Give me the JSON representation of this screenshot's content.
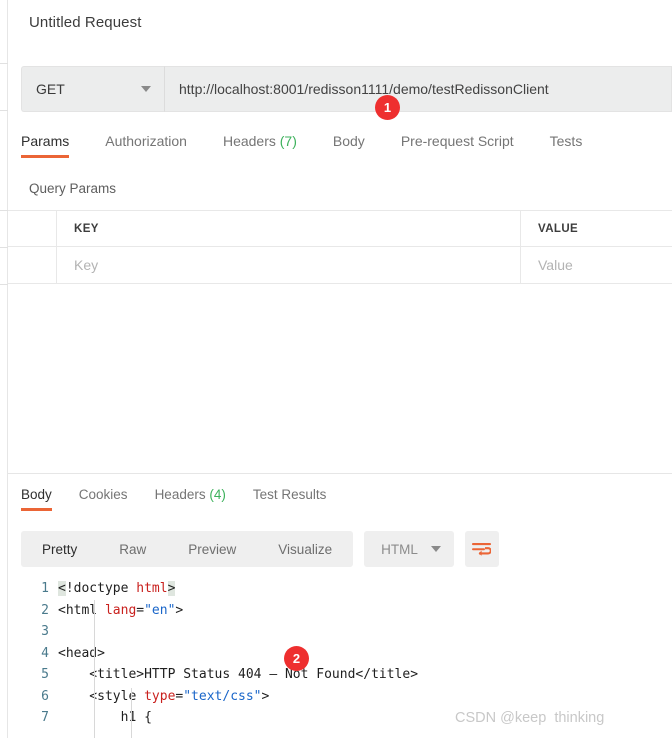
{
  "request": {
    "title": "Untitled Request",
    "method": "GET",
    "method_caret_icon": "chevron-down-icon",
    "url": "http://localhost:8001/redisson1111/demo/testRedissonClient",
    "tabs": [
      {
        "label": "Params",
        "active": true
      },
      {
        "label": "Authorization",
        "active": false
      },
      {
        "label": "Headers",
        "count": "(7)",
        "active": false
      },
      {
        "label": "Body",
        "active": false
      },
      {
        "label": "Pre-request Script",
        "active": false
      },
      {
        "label": "Tests",
        "active": false
      }
    ]
  },
  "query_params": {
    "section_label": "Query Params",
    "columns": [
      "KEY",
      "VALUE"
    ],
    "rows": [
      {
        "key_placeholder": "Key",
        "value_placeholder": "Value"
      }
    ]
  },
  "response": {
    "tabs": [
      {
        "label": "Body",
        "active": true
      },
      {
        "label": "Cookies",
        "active": false
      },
      {
        "label": "Headers",
        "count": "(4)",
        "active": false
      },
      {
        "label": "Test Results",
        "active": false
      }
    ],
    "view_modes": [
      {
        "label": "Pretty",
        "active": true
      },
      {
        "label": "Raw",
        "active": false
      },
      {
        "label": "Preview",
        "active": false
      },
      {
        "label": "Visualize",
        "active": false
      }
    ],
    "format": {
      "label": "HTML",
      "caret_icon": "chevron-down-icon"
    },
    "wrap_button_icon": "wrap-text-icon",
    "code": {
      "language": "html",
      "lines": [
        {
          "n": "1",
          "tokens": [
            {
              "t": "<",
              "c": "brk"
            },
            {
              "t": "!doctype ",
              "c": "plain"
            },
            {
              "t": "html",
              "c": "tag"
            },
            {
              "t": ">",
              "c": "brk"
            }
          ]
        },
        {
          "n": "2",
          "tokens": [
            {
              "t": "<html ",
              "c": "plain"
            },
            {
              "t": "lang",
              "c": "tag"
            },
            {
              "t": "=",
              "c": "plain"
            },
            {
              "t": "\"en\"",
              "c": "str"
            },
            {
              "t": ">",
              "c": "plain"
            }
          ]
        },
        {
          "n": "3",
          "tokens": []
        },
        {
          "n": "4",
          "tokens": [
            {
              "t": "<head>",
              "c": "plain"
            }
          ]
        },
        {
          "n": "5",
          "tokens": [
            {
              "t": "    <title>HTTP Status 404 – Not Found</title>",
              "c": "plain"
            }
          ]
        },
        {
          "n": "6",
          "tokens": [
            {
              "t": "    <style ",
              "c": "plain"
            },
            {
              "t": "type",
              "c": "tag"
            },
            {
              "t": "=",
              "c": "plain"
            },
            {
              "t": "\"text/css\"",
              "c": "str"
            },
            {
              "t": ">",
              "c": "plain"
            }
          ]
        },
        {
          "n": "7",
          "tokens": [
            {
              "t": "        h1 {",
              "c": "plain"
            }
          ]
        }
      ]
    }
  },
  "annotations": [
    {
      "id": "badge1",
      "label": "1"
    },
    {
      "id": "badge2",
      "label": "2"
    }
  ],
  "watermark": "CSDN @keep  thinking",
  "colors": {
    "accent": "#eb6536",
    "badge": "#ee2f2f",
    "count_green": "#3db15c",
    "tag_red": "#c9211e",
    "attr_orange": "#e8590c",
    "string_blue": "#1a66c9",
    "gutter": "#4a7a8c"
  }
}
